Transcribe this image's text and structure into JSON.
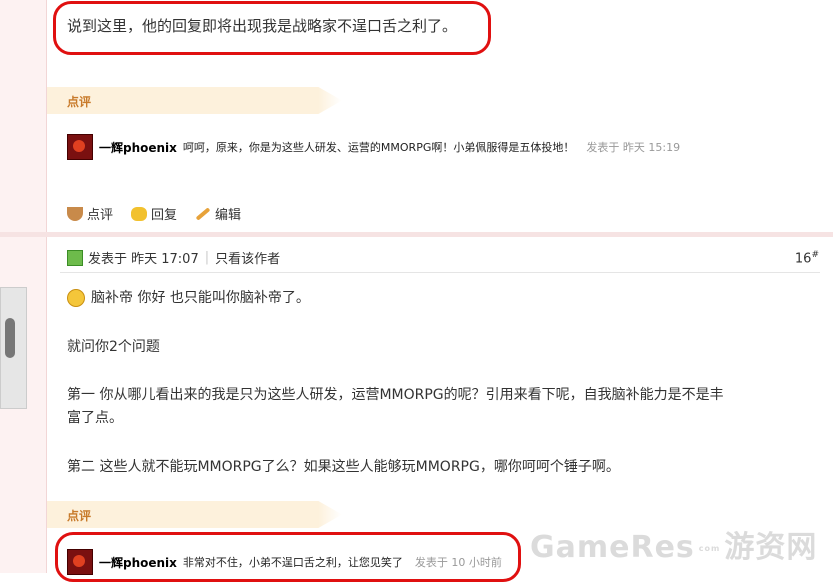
{
  "post15": {
    "last_line": "说到这里，他的回复即将出现我是战略家不逞口舌之利了。"
  },
  "dianping1": {
    "label": "点评",
    "comment": {
      "user": "一辉phoenix",
      "text": "呵呵，原来，你是为这些人研发、运营的MMORPG啊！小弟佩服得是五体投地！",
      "time": "发表于 昨天 15:19"
    }
  },
  "actions": {
    "dianping": "点评",
    "reply": "回复",
    "edit": "编辑"
  },
  "post16": {
    "meta_posted": "发表于 昨天 17:07",
    "meta_only_author": "只看该作者",
    "floor": "16",
    "floor_mark": "#",
    "line1": "脑补帝 你好 也只能叫你脑补帝了。",
    "line2": "就问你2个问题",
    "line3a": "第一 你从哪儿看出来的我是只为这些人研发，运营MMORPG的呢？引用来看下呢，自我脑补能力是不是丰",
    "line3b": "富了点。",
    "line4": "第二 这些人就不能玩MMORPG了么？如果这些人能够玩MMORPG，哪你呵呵个锤子啊。"
  },
  "dianping2": {
    "label": "点评",
    "comment": {
      "user": "一辉phoenix",
      "text": "非常对不住，小弟不逞口舌之利，让您见笑了",
      "time": "发表于 10 小时前"
    }
  },
  "watermark": {
    "brand": "GameRes",
    "small": "com",
    "cn": "游资网"
  },
  "colors": {
    "highlight_red": "#e01010",
    "dianping_bg": "#fdf1dc",
    "dianping_text": "#c87a2a"
  }
}
